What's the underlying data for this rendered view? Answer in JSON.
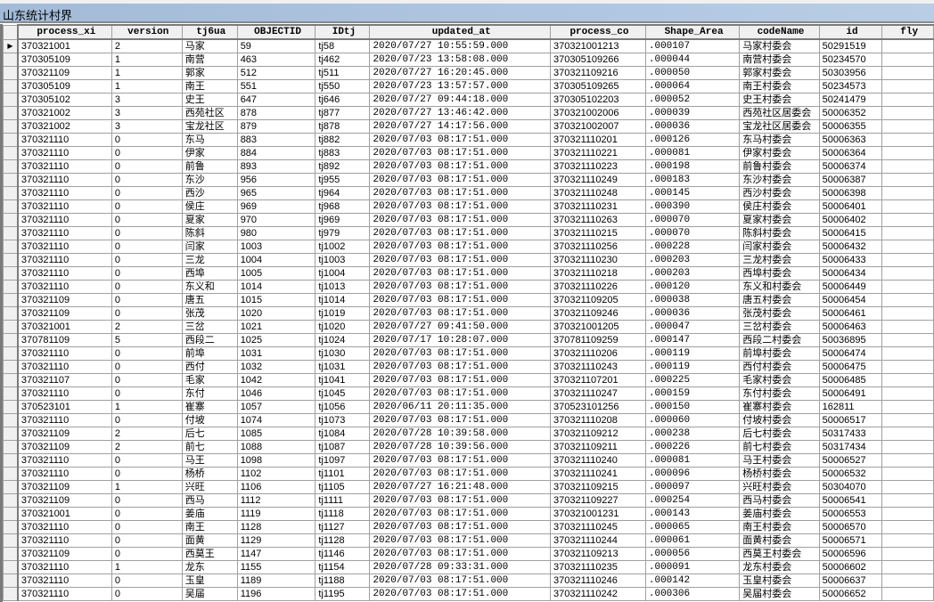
{
  "window": {
    "title": "山东统计村界"
  },
  "table": {
    "columns": [
      "process_xi",
      "version",
      "tj6ua",
      "OBJECTID",
      "IDtj",
      "updated_at",
      "process_co",
      "Shape_Area",
      "codeName",
      "id",
      "fly"
    ],
    "current_row_marker": "▶",
    "rows": [
      [
        "370321001",
        "2",
        "马家",
        "59",
        "tj58",
        "2020/07/27 10:55:59.000",
        "370321001213",
        ".000107",
        "马家村委会",
        "50291519",
        ""
      ],
      [
        "370305109",
        "1",
        "南营",
        "463",
        "tj462",
        "2020/07/23 13:58:08.000",
        "370305109266",
        ".000044",
        "南营村委会",
        "50234570",
        ""
      ],
      [
        "370321109",
        "1",
        "郭家",
        "512",
        "tj511",
        "2020/07/27 16:20:45.000",
        "370321109216",
        ".000050",
        "郭家村委会",
        "50303956",
        ""
      ],
      [
        "370305109",
        "1",
        "南王",
        "551",
        "tj550",
        "2020/07/23 13:57:57.000",
        "370305109265",
        ".000064",
        "南王村委会",
        "50234573",
        ""
      ],
      [
        "370305102",
        "3",
        "史王",
        "647",
        "tj646",
        "2020/07/27 09:44:18.000",
        "370305102203",
        ".000052",
        "史王村委会",
        "50241479",
        ""
      ],
      [
        "370321002",
        "3",
        "西苑社区",
        "878",
        "tj877",
        "2020/07/27 13:46:42.000",
        "370321002006",
        ".000039",
        "西苑社区居委会",
        "50006352",
        ""
      ],
      [
        "370321002",
        "3",
        "宝龙社区",
        "879",
        "tj878",
        "2020/07/27 14:17:56.000",
        "370321002007",
        ".000036",
        "宝龙社区居委会",
        "50006355",
        ""
      ],
      [
        "370321110",
        "0",
        "东马",
        "883",
        "tj882",
        "2020/07/03 08:17:51.000",
        "370321110201",
        ".000126",
        "东马村委会",
        "50006363",
        ""
      ],
      [
        "370321110",
        "0",
        "伊家",
        "884",
        "tj883",
        "2020/07/03 08:17:51.000",
        "370321110221",
        ".000081",
        "伊家村委会",
        "50006364",
        ""
      ],
      [
        "370321110",
        "0",
        "前鲁",
        "893",
        "tj892",
        "2020/07/03 08:17:51.000",
        "370321110223",
        ".000198",
        "前鲁村委会",
        "50006374",
        ""
      ],
      [
        "370321110",
        "0",
        "东沙",
        "956",
        "tj955",
        "2020/07/03 08:17:51.000",
        "370321110249",
        ".000183",
        "东沙村委会",
        "50006387",
        ""
      ],
      [
        "370321110",
        "0",
        "西沙",
        "965",
        "tj964",
        "2020/07/03 08:17:51.000",
        "370321110248",
        ".000145",
        "西沙村委会",
        "50006398",
        ""
      ],
      [
        "370321110",
        "0",
        "侯庄",
        "969",
        "tj968",
        "2020/07/03 08:17:51.000",
        "370321110231",
        ".000390",
        "侯庄村委会",
        "50006401",
        ""
      ],
      [
        "370321110",
        "0",
        "夏家",
        "970",
        "tj969",
        "2020/07/03 08:17:51.000",
        "370321110263",
        ".000070",
        "夏家村委会",
        "50006402",
        ""
      ],
      [
        "370321110",
        "0",
        "陈斜",
        "980",
        "tj979",
        "2020/07/03 08:17:51.000",
        "370321110215",
        ".000070",
        "陈斜村委会",
        "50006415",
        ""
      ],
      [
        "370321110",
        "0",
        "闫家",
        "1003",
        "tj1002",
        "2020/07/03 08:17:51.000",
        "370321110256",
        ".000228",
        "闫家村委会",
        "50006432",
        ""
      ],
      [
        "370321110",
        "0",
        "三龙",
        "1004",
        "tj1003",
        "2020/07/03 08:17:51.000",
        "370321110230",
        ".000203",
        "三龙村委会",
        "50006433",
        ""
      ],
      [
        "370321110",
        "0",
        "西埠",
        "1005",
        "tj1004",
        "2020/07/03 08:17:51.000",
        "370321110218",
        ".000203",
        "西埠村委会",
        "50006434",
        ""
      ],
      [
        "370321110",
        "0",
        "东义和",
        "1014",
        "tj1013",
        "2020/07/03 08:17:51.000",
        "370321110226",
        ".000120",
        "东义和村委会",
        "50006449",
        ""
      ],
      [
        "370321109",
        "0",
        "唐五",
        "1015",
        "tj1014",
        "2020/07/03 08:17:51.000",
        "370321109205",
        ".000038",
        "唐五村委会",
        "50006454",
        ""
      ],
      [
        "370321109",
        "0",
        "张茂",
        "1020",
        "tj1019",
        "2020/07/03 08:17:51.000",
        "370321109246",
        ".000036",
        "张茂村委会",
        "50006461",
        ""
      ],
      [
        "370321001",
        "2",
        "三岔",
        "1021",
        "tj1020",
        "2020/07/27 09:41:50.000",
        "370321001205",
        ".000047",
        "三岔村委会",
        "50006463",
        ""
      ],
      [
        "370781109",
        "5",
        "西段二",
        "1025",
        "tj1024",
        "2020/07/17 10:28:07.000",
        "370781109259",
        ".000147",
        "西段二村委会",
        "50036895",
        ""
      ],
      [
        "370321110",
        "0",
        "前埠",
        "1031",
        "tj1030",
        "2020/07/03 08:17:51.000",
        "370321110206",
        ".000119",
        "前埠村委会",
        "50006474",
        ""
      ],
      [
        "370321110",
        "0",
        "西付",
        "1032",
        "tj1031",
        "2020/07/03 08:17:51.000",
        "370321110243",
        ".000119",
        "西付村委会",
        "50006475",
        ""
      ],
      [
        "370321107",
        "0",
        "毛家",
        "1042",
        "tj1041",
        "2020/07/03 08:17:51.000",
        "370321107201",
        ".000225",
        "毛家村委会",
        "50006485",
        ""
      ],
      [
        "370321110",
        "0",
        "东付",
        "1046",
        "tj1045",
        "2020/07/03 08:17:51.000",
        "370321110247",
        ".000159",
        "东付村委会",
        "50006491",
        ""
      ],
      [
        "370523101",
        "1",
        "崔寨",
        "1057",
        "tj1056",
        "2020/06/11 20:11:35.000",
        "370523101256",
        ".000150",
        "崔寨村委会",
        "162811",
        ""
      ],
      [
        "370321110",
        "0",
        "付坡",
        "1074",
        "tj1073",
        "2020/07/03 08:17:51.000",
        "370321110208",
        ".000060",
        "付坡村委会",
        "50006517",
        ""
      ],
      [
        "370321109",
        "2",
        "后七",
        "1085",
        "tj1084",
        "2020/07/28 10:39:58.000",
        "370321109212",
        ".000238",
        "后七村委会",
        "50317433",
        ""
      ],
      [
        "370321109",
        "2",
        "前七",
        "1088",
        "tj1087",
        "2020/07/28 10:39:56.000",
        "370321109211",
        ".000226",
        "前七村委会",
        "50317434",
        ""
      ],
      [
        "370321110",
        "0",
        "马王",
        "1098",
        "tj1097",
        "2020/07/03 08:17:51.000",
        "370321110240",
        ".000081",
        "马王村委会",
        "50006527",
        ""
      ],
      [
        "370321110",
        "0",
        "杨桥",
        "1102",
        "tj1101",
        "2020/07/03 08:17:51.000",
        "370321110241",
        ".000096",
        "杨桥村委会",
        "50006532",
        ""
      ],
      [
        "370321109",
        "1",
        "兴旺",
        "1106",
        "tj1105",
        "2020/07/27 16:21:48.000",
        "370321109215",
        ".000097",
        "兴旺村委会",
        "50304070",
        ""
      ],
      [
        "370321109",
        "0",
        "西马",
        "1112",
        "tj1111",
        "2020/07/03 08:17:51.000",
        "370321109227",
        ".000254",
        "西马村委会",
        "50006541",
        ""
      ],
      [
        "370321001",
        "0",
        "姜庙",
        "1119",
        "tj1118",
        "2020/07/03 08:17:51.000",
        "370321001231",
        ".000143",
        "姜庙村委会",
        "50006553",
        ""
      ],
      [
        "370321110",
        "0",
        "南王",
        "1128",
        "tj1127",
        "2020/07/03 08:17:51.000",
        "370321110245",
        ".000065",
        "南王村委会",
        "50006570",
        ""
      ],
      [
        "370321110",
        "0",
        "面黄",
        "1129",
        "tj1128",
        "2020/07/03 08:17:51.000",
        "370321110244",
        ".000061",
        "面黄村委会",
        "50006571",
        ""
      ],
      [
        "370321109",
        "0",
        "西莫王",
        "1147",
        "tj1146",
        "2020/07/03 08:17:51.000",
        "370321109213",
        ".000056",
        "西莫王村委会",
        "50006596",
        ""
      ],
      [
        "370321110",
        "1",
        "龙东",
        "1155",
        "tj1154",
        "2020/07/28 09:33:31.000",
        "370321110235",
        ".000091",
        "龙东村委会",
        "50006602",
        ""
      ],
      [
        "370321110",
        "0",
        "玉皇",
        "1189",
        "tj1188",
        "2020/07/03 08:17:51.000",
        "370321110246",
        ".000142",
        "玉皇村委会",
        "50006637",
        ""
      ],
      [
        "370321110",
        "0",
        "吴届",
        "1196",
        "tj1195",
        "2020/07/03 08:17:51.000",
        "370321110242",
        ".000306",
        "吴届村委会",
        "50006652",
        ""
      ]
    ]
  }
}
